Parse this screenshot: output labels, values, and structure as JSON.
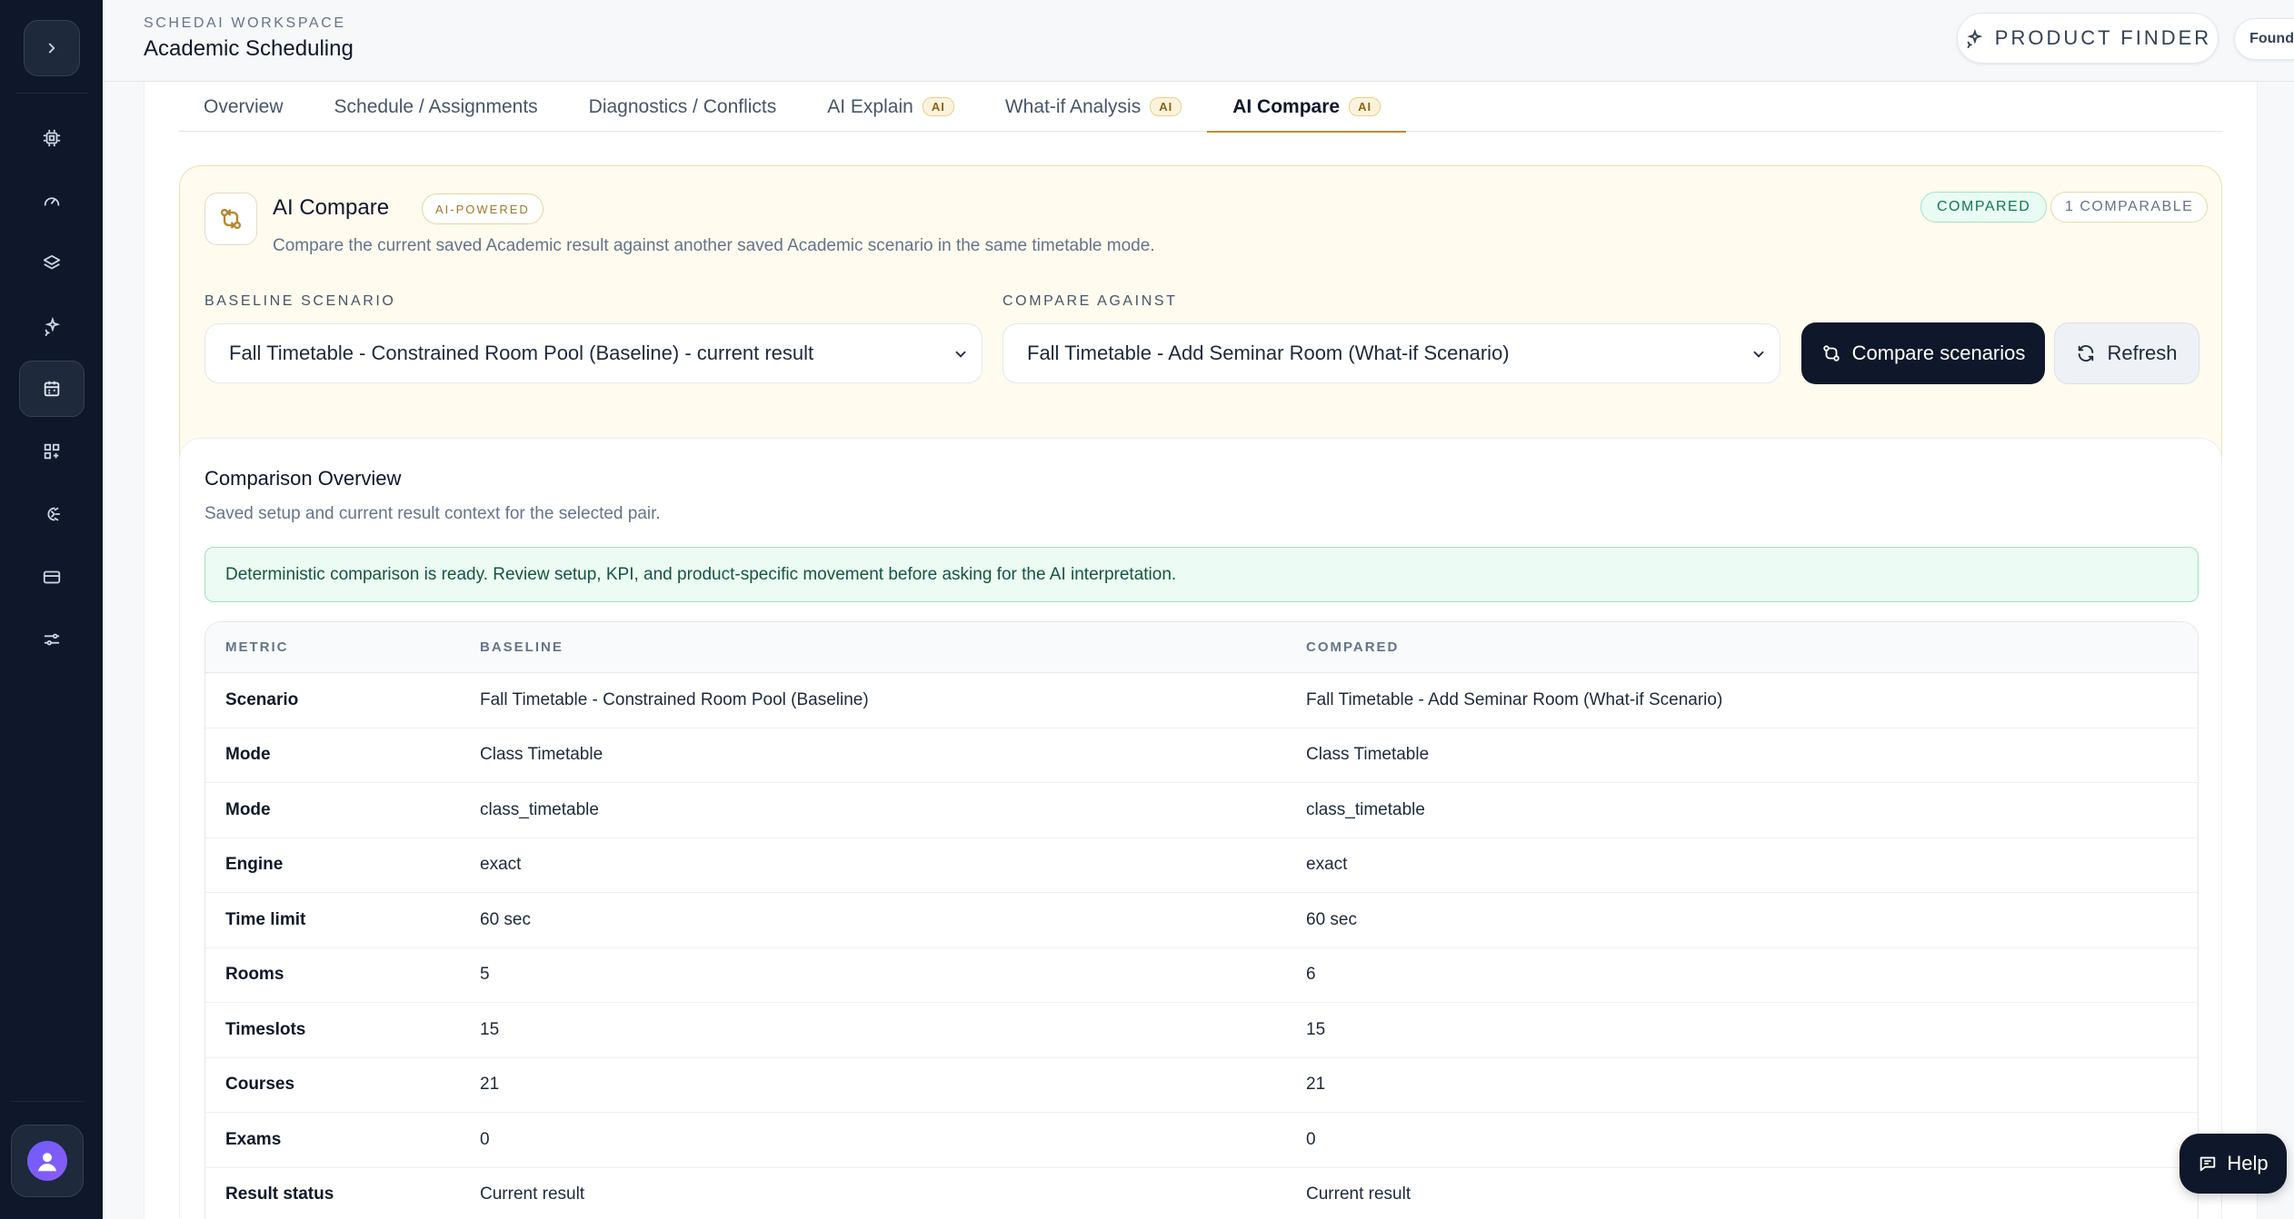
{
  "header": {
    "workspace": "SCHEDAI WORKSPACE",
    "title": "Academic Scheduling",
    "product_finder": "PRODUCT FINDER",
    "account": "Founder account"
  },
  "tabs": [
    {
      "label": "Overview",
      "ai": ""
    },
    {
      "label": "Schedule / Assignments",
      "ai": ""
    },
    {
      "label": "Diagnostics / Conflicts",
      "ai": ""
    },
    {
      "label": "AI Explain",
      "ai": "AI"
    },
    {
      "label": "What-if Analysis",
      "ai": "AI"
    },
    {
      "label": "AI Compare",
      "ai": "AI"
    }
  ],
  "compare": {
    "title": "AI Compare",
    "powered": "AI-POWERED",
    "description": "Compare the current saved Academic result against another saved Academic scenario in the same timetable mode.",
    "status_badge": "COMPARED",
    "count_badge": "1 COMPARABLE",
    "baseline_label": "BASELINE SCENARIO",
    "baseline_value": "Fall Timetable - Constrained Room Pool (Baseline) - current result",
    "against_label": "COMPARE AGAINST",
    "against_value": "Fall Timetable - Add Seminar Room (What-if Scenario)",
    "compare_button": "Compare scenarios",
    "refresh_button": "Refresh"
  },
  "overview": {
    "title": "Comparison Overview",
    "subtitle": "Saved setup and current result context for the selected pair.",
    "alert": "Deterministic comparison is ready. Review setup, KPI, and product-specific movement before asking for the AI interpretation.",
    "columns": [
      "METRIC",
      "BASELINE",
      "COMPARED"
    ],
    "rows": [
      [
        "Scenario",
        "Fall Timetable - Constrained Room Pool (Baseline)",
        "Fall Timetable - Add Seminar Room (What-if Scenario)"
      ],
      [
        "Mode",
        "Class Timetable",
        "Class Timetable"
      ],
      [
        "Mode",
        "class_timetable",
        "class_timetable"
      ],
      [
        "Engine",
        "exact",
        "exact"
      ],
      [
        "Time limit",
        "60 sec",
        "60 sec"
      ],
      [
        "Rooms",
        "5",
        "6"
      ],
      [
        "Timeslots",
        "15",
        "15"
      ],
      [
        "Courses",
        "21",
        "21"
      ],
      [
        "Exams",
        "0",
        "0"
      ],
      [
        "Result status",
        "Current result",
        "Current result"
      ]
    ]
  },
  "help": {
    "label": "Help"
  },
  "sidebar": {
    "icons": [
      "chip-icon",
      "gauge-icon",
      "layers-icon",
      "sparkle-icon",
      "calendar-icon",
      "widgets-icon",
      "ai-brain-icon",
      "card-icon",
      "sliders-icon"
    ],
    "active_index": 4
  }
}
